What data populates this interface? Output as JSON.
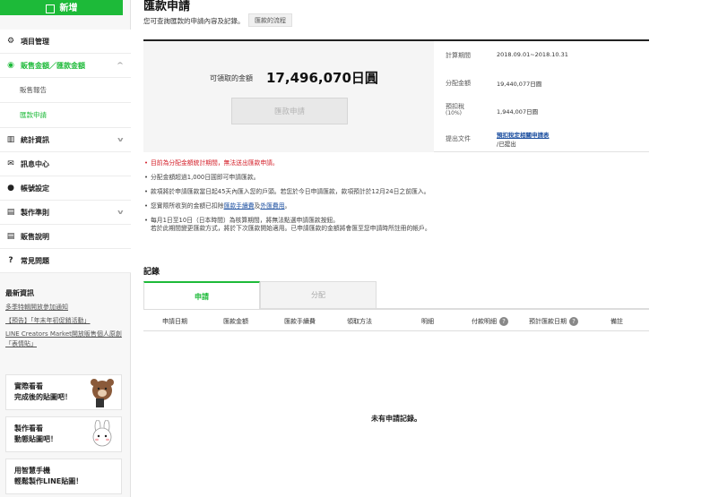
{
  "sidebar": {
    "new_button": "新增",
    "menu": [
      {
        "label": "項目管理",
        "icon": "gear-icon"
      },
      {
        "label": "販售金額／匯款金額",
        "icon": "coin-icon"
      },
      {
        "label": "統計資訊",
        "icon": "chart-icon"
      },
      {
        "label": "訊息中心",
        "icon": "mail-icon"
      },
      {
        "label": "帳號設定",
        "icon": "user-icon"
      },
      {
        "label": "製作準則",
        "icon": "book-icon"
      },
      {
        "label": "販售說明",
        "icon": "book-icon"
      },
      {
        "label": "常見問題",
        "icon": "help-icon"
      }
    ],
    "submenu": [
      "販售報告",
      "匯款申請"
    ],
    "news_title": "最新資訊",
    "news": [
      "多季特輯開放參加通知",
      "【預告】「年末年初促銷活動」",
      "LINE Creators Market開放販售個人原創「表情貼」"
    ],
    "promos": [
      "實際看看\n完成後的貼圖吧！",
      "製作看看\n動態貼圖吧！",
      "用智慧手機\n輕鬆製作LINE貼圖！"
    ]
  },
  "header": {
    "title": "匯款申請",
    "description": "您可查詢匯款的申請內容及記錄。",
    "flow_button": "匯款的流程"
  },
  "summary": {
    "amount_label": "可領取的金額",
    "amount_value": "17,496,070日圓",
    "apply_button": "匯款申請",
    "rows": [
      {
        "label": "計算期間",
        "value": "2018.09.01~2018.10.31"
      },
      {
        "label": "分配金額",
        "value": "19,440,077日圓"
      },
      {
        "label": "預扣稅",
        "sub": "(10%)",
        "value": "1,944,007日圓"
      },
      {
        "label": "提出文件",
        "link": "預扣稅定相關申請表",
        "value": "/已提出"
      }
    ]
  },
  "notes": {
    "n1": "目前為分配金額統計期間，無法送出匯款申請。",
    "n2": "分配金額超過1,000日圓即可申請匯款。",
    "n3": "款項將於申請匯款當日起45天內匯入您的戶頭。若您於今日申請匯款，款項預計於12月24日之前匯入。",
    "n4_pre": "您實際所收到的金額已扣除",
    "n4_link1": "匯款手續費",
    "n4_mid": "及",
    "n4_link2": "外匯費用",
    "n4_post": "。",
    "n5a": "每月1日至10日（日本時間）為核算期間，將無法點選申請匯款按鈕。",
    "n5b": "若於此期間變更匯款方式，將於下次匯款開始適用。已申請匯款的金額將會匯至您申請時所註冊的帳戶。"
  },
  "records": {
    "title": "記錄",
    "tabs": [
      "申請",
      "分配"
    ],
    "columns": [
      "申請日期",
      "匯款金額",
      "匯款手續費",
      "領取方法",
      "明細",
      "付款明細",
      "預計匯款日期",
      "備註"
    ],
    "empty": "未有申請記錄。"
  },
  "colors": {
    "accent": "#1dba39",
    "alert": "#d4202a",
    "link": "#1c4fa0"
  }
}
